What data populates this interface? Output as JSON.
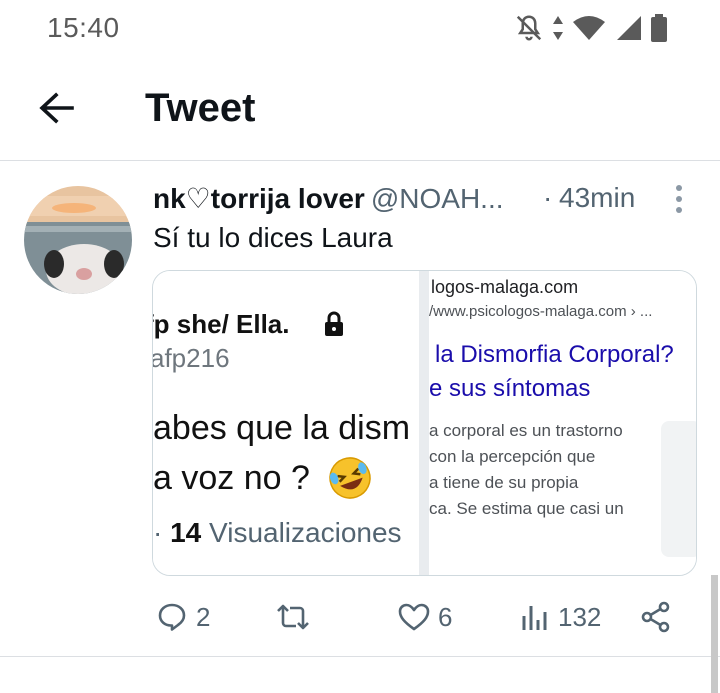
{
  "status_bar": {
    "time": "15:40",
    "icons": [
      "bell-off-icon",
      "data-arrows-icon",
      "wifi-icon",
      "signal-icon",
      "battery-icon"
    ]
  },
  "header": {
    "title": "Tweet",
    "back_icon": "arrow-left-icon"
  },
  "tweet": {
    "display_name": "nk♡torrija lover",
    "handle": "@NOAH...",
    "separator": "·",
    "time": "43min",
    "text": "Sí tu lo dices Laura",
    "media_left": {
      "name": "fp she/ Ella.",
      "handle": "afp216",
      "line1": "abes que la dism",
      "line2": "a voz no ?",
      "views_prefix": "·",
      "views_count": "14",
      "views_label": "Visualizaciones"
    },
    "media_right": {
      "site": "logos-malaga.com",
      "url": "/www.psicologos-malaga.com › ...",
      "title1": "la Dismorfia Corporal?",
      "title2": "e sus síntomas",
      "snippet": [
        "a corporal es un trastorno",
        "con la percepción que",
        "a tiene de su propia",
        "ca. Se estima que casi un"
      ]
    },
    "actions": {
      "replies": "2",
      "likes": "6",
      "views": "132"
    }
  },
  "colors": {
    "accent_blue": "#1a0dab",
    "muted": "#536471",
    "text": "#0f1419"
  }
}
